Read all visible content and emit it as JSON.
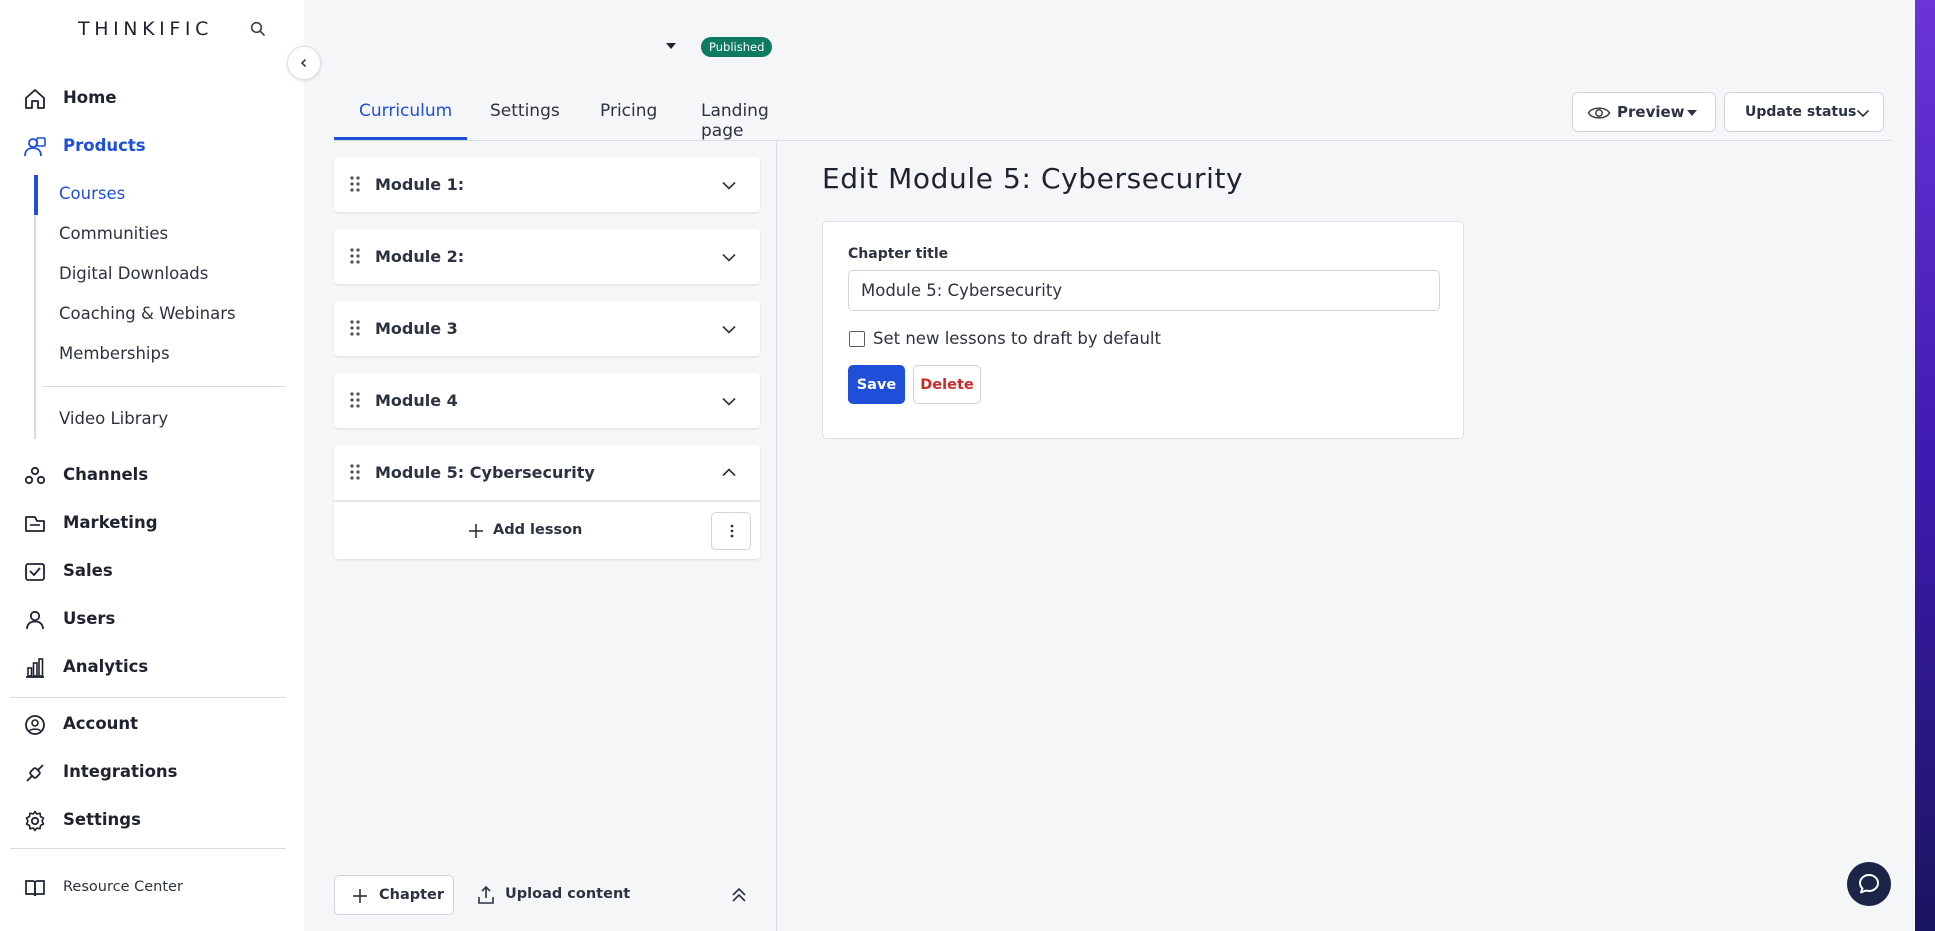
{
  "app": {
    "logo": "THINKIFIC"
  },
  "sidebar": {
    "nav": [
      {
        "label": "Home",
        "icon": "home-icon"
      },
      {
        "label": "Products",
        "icon": "products-icon"
      },
      {
        "label": "Channels",
        "icon": "channels-icon"
      },
      {
        "label": "Marketing",
        "icon": "marketing-icon"
      },
      {
        "label": "Sales",
        "icon": "sales-icon"
      },
      {
        "label": "Users",
        "icon": "users-icon"
      },
      {
        "label": "Analytics",
        "icon": "analytics-icon"
      },
      {
        "label": "Account",
        "icon": "account-icon"
      },
      {
        "label": "Integrations",
        "icon": "integrations-icon"
      },
      {
        "label": "Settings",
        "icon": "settings-icon"
      }
    ],
    "products_sub": [
      "Courses",
      "Communities",
      "Digital Downloads",
      "Coaching & Webinars",
      "Memberships",
      "Video Library"
    ],
    "resource_center": "Resource Center",
    "accent_color": "#1f4fd8"
  },
  "header": {
    "course_title": "",
    "status_badge": "Published",
    "status_color": "#0e7a5f",
    "tabs": [
      "Curriculum",
      "Settings",
      "Pricing",
      "Landing page"
    ],
    "active_tab": "Curriculum",
    "preview_label": "Preview",
    "update_status_label": "Update status"
  },
  "curriculum": {
    "modules": [
      "Module 1:",
      "Module 2:",
      "Module 3",
      "Module 4",
      "Module 5: Cybersecurity"
    ],
    "expanded_module": "Module 5: Cybersecurity",
    "add_lesson_label": "Add lesson",
    "chapter_button_label": "Chapter",
    "upload_button_label": "Upload content"
  },
  "editor": {
    "heading": "Edit Module 5: Cybersecurity",
    "chapter_title_label": "Chapter title",
    "chapter_title_value": "Module 5: Cybersecurity",
    "draft_checkbox_label": "Set new lessons to draft by default",
    "draft_checkbox_checked": false,
    "save_label": "Save",
    "delete_label": "Delete"
  }
}
